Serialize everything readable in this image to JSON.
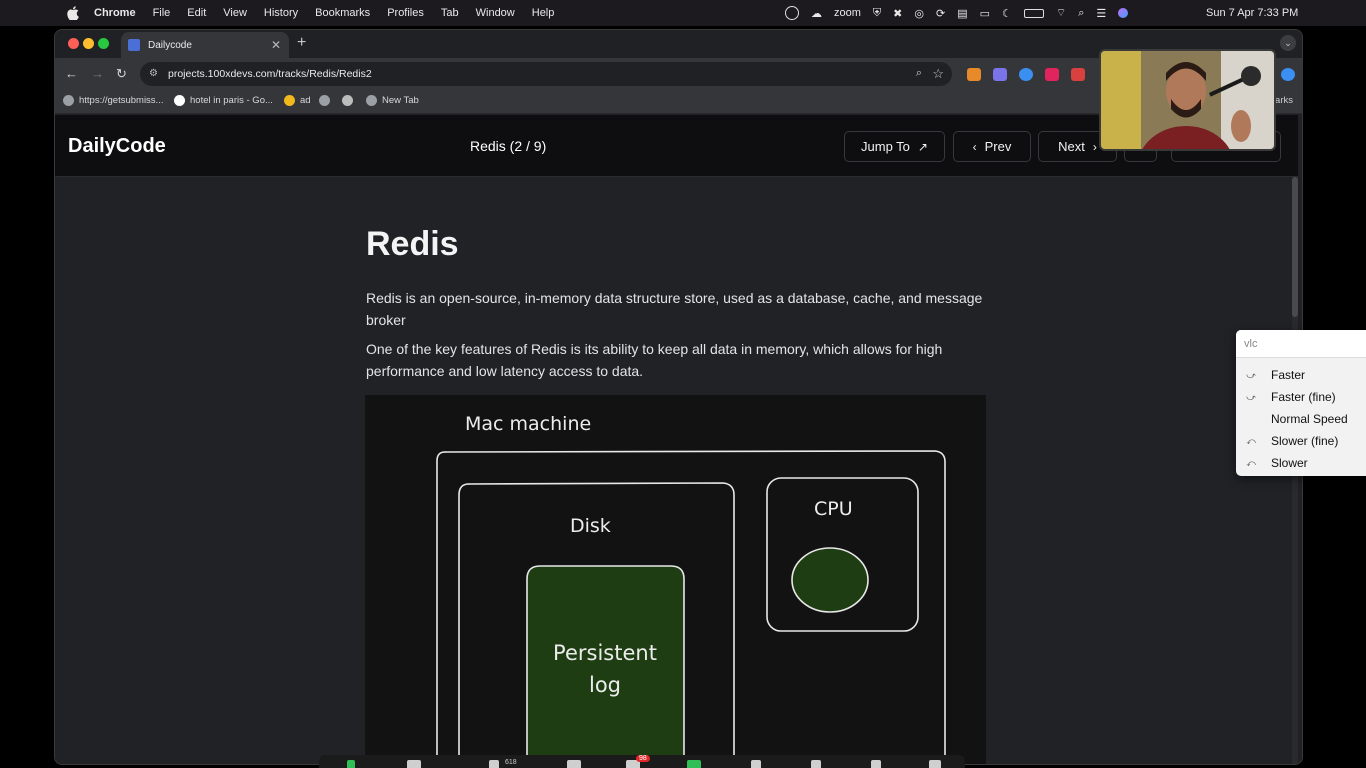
{
  "menubar": {
    "app_name": "Chrome",
    "items": [
      "File",
      "Edit",
      "View",
      "History",
      "Bookmarks",
      "Profiles",
      "Tab",
      "Window",
      "Help"
    ],
    "zoom_label": "zoom",
    "clock": "Sun 7 Apr  7:33 PM"
  },
  "browser": {
    "tab_title": "Dailycode",
    "url": "projects.100xdevs.com/tracks/Redis/Redis2",
    "bookmarks": [
      {
        "label": "https://getsubmiss..."
      },
      {
        "label": "hotel in paris - Go..."
      },
      {
        "label": "ad"
      },
      {
        "label": ""
      },
      {
        "label": ""
      },
      {
        "label": "New Tab"
      }
    ],
    "all_bookmarks_partial": "arks"
  },
  "app": {
    "logo": "DailyCode",
    "track_title": "Redis (2 / 9)",
    "jump_to": "Jump To",
    "prev": "Prev",
    "next": "Next"
  },
  "article": {
    "heading": "Redis",
    "paragraphs": [
      "Redis is an open-source, in-memory data structure store, used as a database, cache, and message broker",
      "One of the key features of Redis is its ability to keep all data in memory, which allows for high performance and low latency access to data."
    ]
  },
  "diagram": {
    "machine_label": "Mac machine",
    "disk_label": "Disk",
    "cpu_label": "CPU",
    "log_label_line1": "Persistent",
    "log_label_line2": "log",
    "fill_color": "#1f3d12"
  },
  "vlc": {
    "search": "vlc",
    "items": [
      "Faster",
      "Faster (fine)",
      "Normal Speed",
      "Slower (fine)",
      "Slower"
    ]
  },
  "zoom_controls": {
    "participants": "618",
    "chat_badge": "98"
  }
}
